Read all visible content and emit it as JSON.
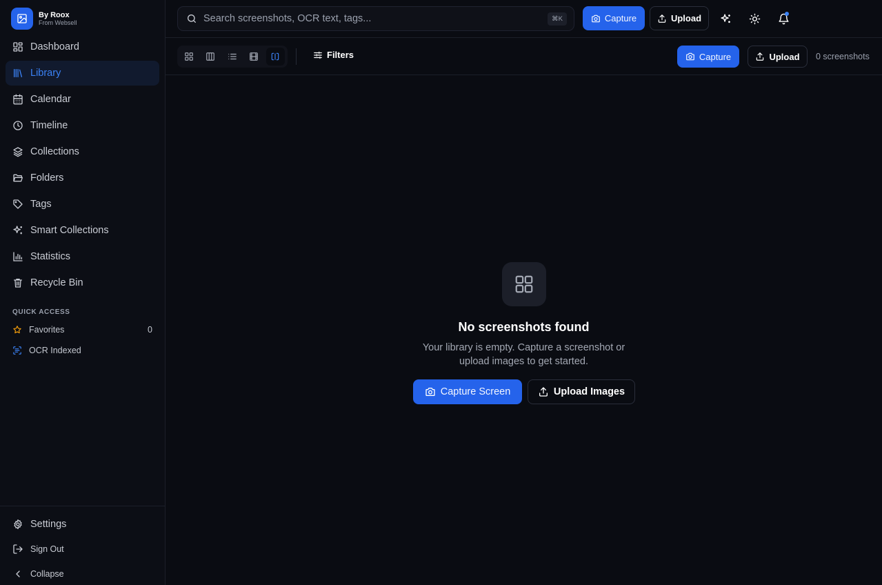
{
  "brand": {
    "name": "By Roox",
    "sub": "From Websell"
  },
  "sidebar": {
    "items": [
      {
        "label": "Dashboard",
        "icon": "dashboard-icon"
      },
      {
        "label": "Library",
        "icon": "library-icon",
        "active": true
      },
      {
        "label": "Calendar",
        "icon": "calendar-icon"
      },
      {
        "label": "Timeline",
        "icon": "clock-icon"
      },
      {
        "label": "Collections",
        "icon": "layers-icon"
      },
      {
        "label": "Folders",
        "icon": "folder-icon"
      },
      {
        "label": "Tags",
        "icon": "tag-icon"
      },
      {
        "label": "Smart Collections",
        "icon": "sparkles-icon"
      },
      {
        "label": "Statistics",
        "icon": "bar-chart-icon"
      },
      {
        "label": "Recycle Bin",
        "icon": "trash-icon"
      }
    ],
    "quick_access_title": "QUICK ACCESS",
    "quick_access": [
      {
        "label": "Favorites",
        "count": "0",
        "icon": "star-icon"
      },
      {
        "label": "OCR Indexed",
        "icon": "scan-text-icon"
      }
    ],
    "bottom": {
      "settings": "Settings",
      "sign_out": "Sign Out",
      "collapse": "Collapse"
    }
  },
  "topbar": {
    "search_placeholder": "Search screenshots, OCR text, tags...",
    "shortcut": "⌘K",
    "capture": "Capture",
    "upload": "Upload"
  },
  "toolbar": {
    "filters": "Filters",
    "capture": "Capture",
    "upload": "Upload",
    "count": "0 screenshots",
    "active_view": "split"
  },
  "empty": {
    "title": "No screenshots found",
    "description": "Your library is empty. Capture a screenshot or upload images to get started.",
    "capture_button": "Capture Screen",
    "upload_button": "Upload Images"
  },
  "colors": {
    "accent": "#2563eb",
    "accent_text": "#3b82f6",
    "background": "#0a0c12",
    "sidebar": "#0c0e15",
    "favorite_star": "#f59e0b"
  }
}
